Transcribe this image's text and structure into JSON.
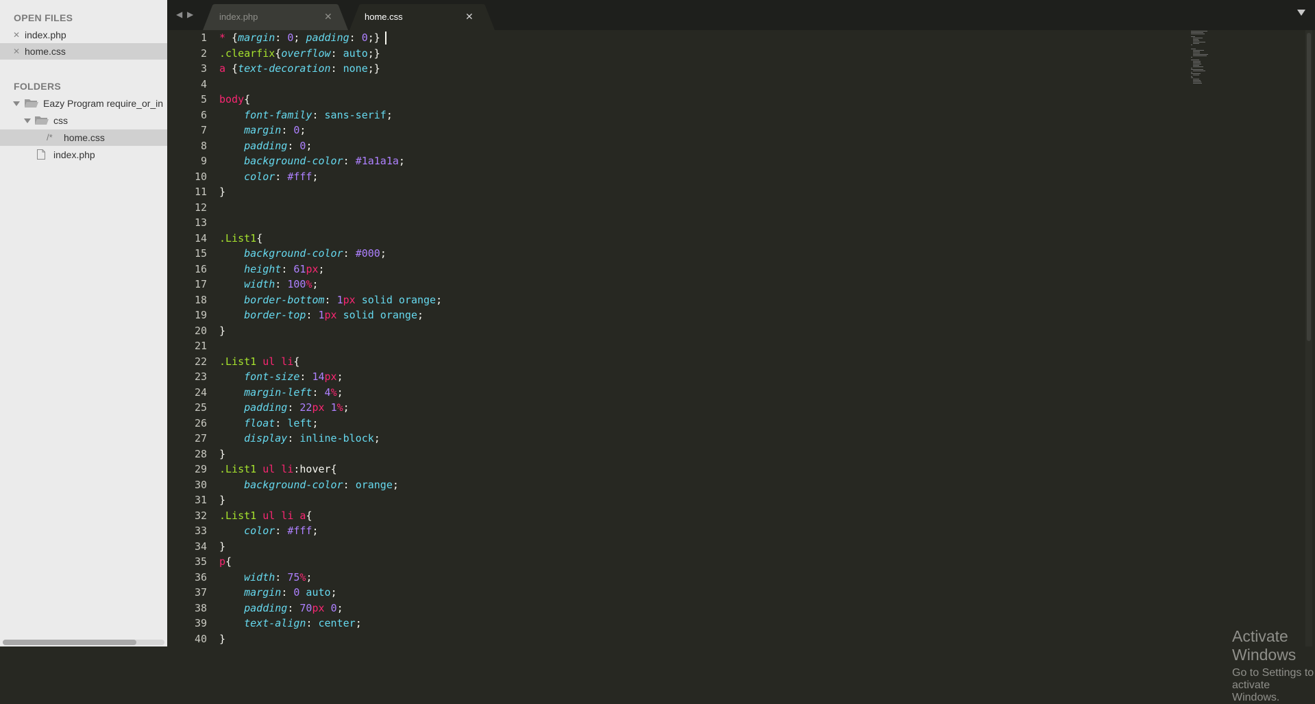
{
  "sidebar": {
    "open_files_title": "OPEN FILES",
    "open_files": [
      {
        "name": "index.php",
        "selected": false
      },
      {
        "name": "home.css",
        "selected": true
      }
    ],
    "folders_title": "FOLDERS",
    "folder_root": "Eazy Program require_or_in",
    "subfolder": "css",
    "subfolder_file": "home.css",
    "subfolder_file_glyph": "/*",
    "root_file": "index.php",
    "close_glyph": "✕"
  },
  "tabs": [
    {
      "label": "index.php",
      "active": false
    },
    {
      "label": "home.css",
      "active": true
    }
  ],
  "tab_close_glyph": "✕",
  "nav": {
    "back": "◀",
    "forward": "▶"
  },
  "editor": {
    "line_numbers": [
      "1",
      "2",
      "3",
      "4",
      "5",
      "6",
      "7",
      "8",
      "9",
      "10",
      "11",
      "12",
      "13",
      "14",
      "15",
      "16",
      "17",
      "18",
      "19",
      "20",
      "21",
      "22",
      "23",
      "24",
      "25",
      "26",
      "27",
      "28",
      "29",
      "30",
      "31",
      "32",
      "33",
      "34",
      "35",
      "36",
      "37",
      "38",
      "39",
      "40"
    ],
    "lines": [
      [
        [
          "star",
          "*"
        ],
        [
          "punc",
          " {"
        ],
        [
          "prop",
          "margin"
        ],
        [
          "punc",
          ": "
        ],
        [
          "num",
          "0"
        ],
        [
          "punc",
          "; "
        ],
        [
          "prop",
          "padding"
        ],
        [
          "punc",
          ": "
        ],
        [
          "num",
          "0"
        ],
        [
          "punc",
          ";}"
        ]
      ],
      [
        [
          "class",
          ".clearfix"
        ],
        [
          "punc",
          "{"
        ],
        [
          "prop",
          "overflow"
        ],
        [
          "punc",
          ": "
        ],
        [
          "value",
          "auto"
        ],
        [
          "punc",
          ";}"
        ]
      ],
      [
        [
          "selector",
          "a"
        ],
        [
          "punc",
          " {"
        ],
        [
          "prop",
          "text-decoration"
        ],
        [
          "punc",
          ": "
        ],
        [
          "value",
          "none"
        ],
        [
          "punc",
          ";}"
        ]
      ],
      [],
      [
        [
          "selector",
          "body"
        ],
        [
          "punc",
          "{"
        ]
      ],
      [
        [
          "punc",
          "    "
        ],
        [
          "prop",
          "font-family"
        ],
        [
          "punc",
          ": "
        ],
        [
          "value",
          "sans-serif"
        ],
        [
          "punc",
          ";"
        ]
      ],
      [
        [
          "punc",
          "    "
        ],
        [
          "prop",
          "margin"
        ],
        [
          "punc",
          ": "
        ],
        [
          "num",
          "0"
        ],
        [
          "punc",
          ";"
        ]
      ],
      [
        [
          "punc",
          "    "
        ],
        [
          "prop",
          "padding"
        ],
        [
          "punc",
          ": "
        ],
        [
          "num",
          "0"
        ],
        [
          "punc",
          ";"
        ]
      ],
      [
        [
          "punc",
          "    "
        ],
        [
          "prop",
          "background-color"
        ],
        [
          "punc",
          ": "
        ],
        [
          "hex",
          "#1a1a1a"
        ],
        [
          "punc",
          ";"
        ]
      ],
      [
        [
          "punc",
          "    "
        ],
        [
          "prop",
          "color"
        ],
        [
          "punc",
          ": "
        ],
        [
          "hex",
          "#fff"
        ],
        [
          "punc",
          ";"
        ]
      ],
      [
        [
          "punc",
          "}"
        ]
      ],
      [],
      [],
      [
        [
          "class",
          ".List1"
        ],
        [
          "punc",
          "{"
        ]
      ],
      [
        [
          "punc",
          "    "
        ],
        [
          "prop",
          "background-color"
        ],
        [
          "punc",
          ": "
        ],
        [
          "hex",
          "#000"
        ],
        [
          "punc",
          ";"
        ]
      ],
      [
        [
          "punc",
          "    "
        ],
        [
          "prop",
          "height"
        ],
        [
          "punc",
          ": "
        ],
        [
          "num",
          "61"
        ],
        [
          "unit",
          "px"
        ],
        [
          "punc",
          ";"
        ]
      ],
      [
        [
          "punc",
          "    "
        ],
        [
          "prop",
          "width"
        ],
        [
          "punc",
          ": "
        ],
        [
          "num",
          "100"
        ],
        [
          "unit",
          "%"
        ],
        [
          "punc",
          ";"
        ]
      ],
      [
        [
          "punc",
          "    "
        ],
        [
          "prop",
          "border-bottom"
        ],
        [
          "punc",
          ": "
        ],
        [
          "num",
          "1"
        ],
        [
          "unit",
          "px"
        ],
        [
          "value",
          " solid orange"
        ],
        [
          "punc",
          ";"
        ]
      ],
      [
        [
          "punc",
          "    "
        ],
        [
          "prop",
          "border-top"
        ],
        [
          "punc",
          ": "
        ],
        [
          "num",
          "1"
        ],
        [
          "unit",
          "px"
        ],
        [
          "value",
          " solid orange"
        ],
        [
          "punc",
          ";"
        ]
      ],
      [
        [
          "punc",
          "}"
        ]
      ],
      [],
      [
        [
          "class",
          ".List1"
        ],
        [
          "selector",
          " ul li"
        ],
        [
          "punc",
          "{"
        ]
      ],
      [
        [
          "punc",
          "    "
        ],
        [
          "prop",
          "font-size"
        ],
        [
          "punc",
          ": "
        ],
        [
          "num",
          "14"
        ],
        [
          "unit",
          "px"
        ],
        [
          "punc",
          ";"
        ]
      ],
      [
        [
          "punc",
          "    "
        ],
        [
          "prop",
          "margin-left"
        ],
        [
          "punc",
          ": "
        ],
        [
          "num",
          "4"
        ],
        [
          "unit",
          "%"
        ],
        [
          "punc",
          ";"
        ]
      ],
      [
        [
          "punc",
          "    "
        ],
        [
          "prop",
          "padding"
        ],
        [
          "punc",
          ": "
        ],
        [
          "num",
          "22"
        ],
        [
          "unit",
          "px"
        ],
        [
          "punc",
          " "
        ],
        [
          "num",
          "1"
        ],
        [
          "unit",
          "%"
        ],
        [
          "punc",
          ";"
        ]
      ],
      [
        [
          "punc",
          "    "
        ],
        [
          "prop",
          "float"
        ],
        [
          "punc",
          ": "
        ],
        [
          "value",
          "left"
        ],
        [
          "punc",
          ";"
        ]
      ],
      [
        [
          "punc",
          "    "
        ],
        [
          "prop",
          "display"
        ],
        [
          "punc",
          ": "
        ],
        [
          "value",
          "inline-block"
        ],
        [
          "punc",
          ";"
        ]
      ],
      [
        [
          "punc",
          "}"
        ]
      ],
      [
        [
          "class",
          ".List1"
        ],
        [
          "selector",
          " ul li"
        ],
        [
          "pseudo",
          ":hover"
        ],
        [
          "punc",
          "{"
        ]
      ],
      [
        [
          "punc",
          "    "
        ],
        [
          "prop",
          "background-color"
        ],
        [
          "punc",
          ": "
        ],
        [
          "value",
          "orange"
        ],
        [
          "punc",
          ";"
        ]
      ],
      [
        [
          "punc",
          "}"
        ]
      ],
      [
        [
          "class",
          ".List1"
        ],
        [
          "selector",
          " ul li a"
        ],
        [
          "punc",
          "{"
        ]
      ],
      [
        [
          "punc",
          "    "
        ],
        [
          "prop",
          "color"
        ],
        [
          "punc",
          ": "
        ],
        [
          "hex",
          "#fff"
        ],
        [
          "punc",
          ";"
        ]
      ],
      [
        [
          "punc",
          "}"
        ]
      ],
      [
        [
          "selector",
          "p"
        ],
        [
          "punc",
          "{"
        ]
      ],
      [
        [
          "punc",
          "    "
        ],
        [
          "prop",
          "width"
        ],
        [
          "punc",
          ": "
        ],
        [
          "num",
          "75"
        ],
        [
          "unit",
          "%"
        ],
        [
          "punc",
          ";"
        ]
      ],
      [
        [
          "punc",
          "    "
        ],
        [
          "prop",
          "margin"
        ],
        [
          "punc",
          ": "
        ],
        [
          "num",
          "0"
        ],
        [
          "value",
          " auto"
        ],
        [
          "punc",
          ";"
        ]
      ],
      [
        [
          "punc",
          "    "
        ],
        [
          "prop",
          "padding"
        ],
        [
          "punc",
          ": "
        ],
        [
          "num",
          "70"
        ],
        [
          "unit",
          "px"
        ],
        [
          "punc",
          " "
        ],
        [
          "num",
          "0"
        ],
        [
          "punc",
          ";"
        ]
      ],
      [
        [
          "punc",
          "    "
        ],
        [
          "prop",
          "text-align"
        ],
        [
          "punc",
          ": "
        ],
        [
          "value",
          "center"
        ],
        [
          "punc",
          ";"
        ]
      ],
      [
        [
          "punc",
          "}"
        ]
      ]
    ]
  },
  "watermark": {
    "title": "Activate Windows",
    "subtitle": "Go to Settings to activate Windows."
  },
  "colors": {
    "editor_bg": "#272822",
    "sidebar_bg": "#ebebeb",
    "tab_active": "#272822",
    "tab_inactive": "#3a3b36",
    "selector": "#f92672",
    "class": "#a6e22e",
    "property": "#66d9ef",
    "number": "#ae81ff"
  }
}
